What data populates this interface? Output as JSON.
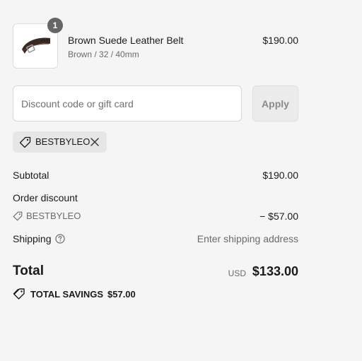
{
  "product": {
    "quantity": "1",
    "name": "Brown Suede Leather Belt",
    "variant": "Brown / 32 / 40mm",
    "price": "$190.00",
    "image_icon": "belt-image"
  },
  "discount": {
    "placeholder": "Discount code or gift card",
    "value": "",
    "apply_label": "Apply",
    "applied_code": "BESTBYLEO"
  },
  "totals": {
    "subtotal_label": "Subtotal",
    "subtotal_value": "$190.00",
    "order_discount_label": "Order discount",
    "discount_code": "BESTBYLEO",
    "discount_value": "− $57.00",
    "shipping_label": "Shipping",
    "shipping_value": "Enter shipping address",
    "total_label": "Total",
    "currency": "USD",
    "total_value": "$133.00",
    "savings_label": "TOTAL SAVINGS",
    "savings_value": "$57.00"
  },
  "colors": {
    "background": "#f5f5f5",
    "badge": "#666666",
    "chip": "#e6e6e6",
    "muted_text": "#6b6b6b"
  }
}
